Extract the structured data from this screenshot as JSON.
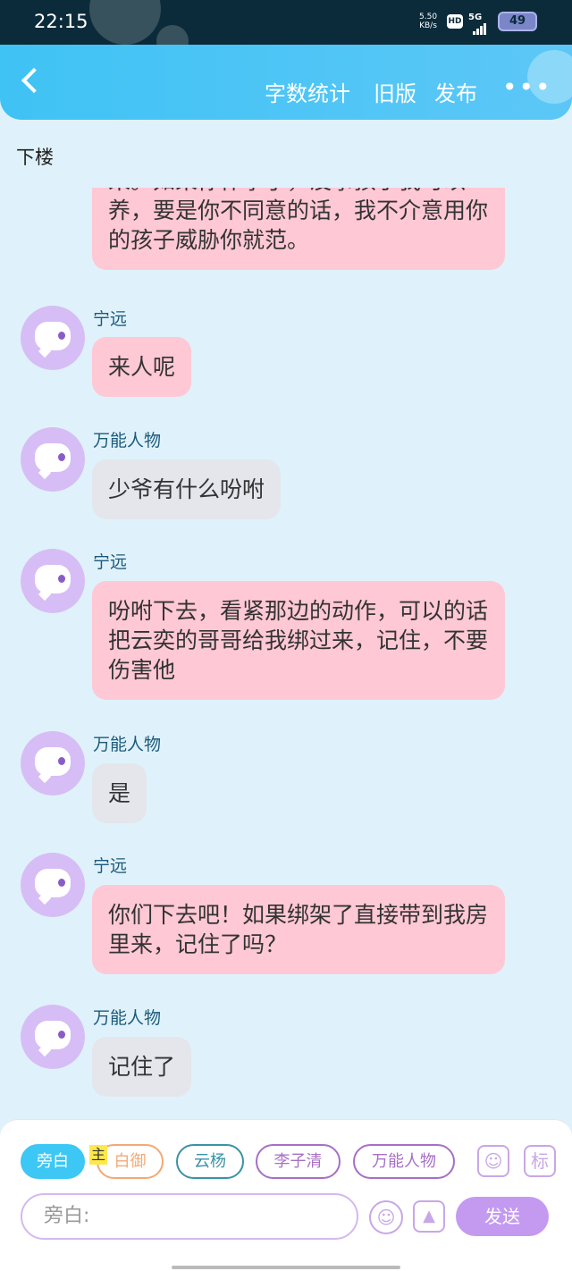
{
  "status": {
    "time": "22:15",
    "net_speed": "5.50",
    "net_unit": "KB/s",
    "hd": "HD",
    "signal": "5G",
    "battery": "49"
  },
  "header": {
    "actions": [
      "字数统计",
      "旧版",
      "发布"
    ],
    "more": "•••"
  },
  "section_label": "下楼",
  "messages": [
    {
      "type": "partial",
      "color": "pink",
      "text": "来。如果你怀孕了，没事孩子我可以养，要是你不同意的话，我不介意用你的孩子威胁你就范。"
    },
    {
      "name": "宁远",
      "color": "pink",
      "text": "来人呢"
    },
    {
      "name": "万能人物",
      "color": "gray",
      "text": "少爷有什么吩咐"
    },
    {
      "name": "宁远",
      "color": "pink",
      "text": "吩咐下去，看紧那边的动作，可以的话把云奕的哥哥给我绑过来，记住，不要伤害他"
    },
    {
      "name": "万能人物",
      "color": "gray",
      "text": "是"
    },
    {
      "name": "宁远",
      "color": "pink",
      "text": "你们下去吧！如果绑架了直接带到我房里来，记住了吗？"
    },
    {
      "name": "万能人物",
      "color": "gray",
      "text": "记住了"
    }
  ],
  "composer": {
    "chips": [
      "旁白",
      "白御",
      "云杨",
      "李子清",
      "万能人物"
    ],
    "main_tag": "主",
    "tag_button": "标",
    "input_placeholder": "旁白:",
    "send_label": "发送"
  }
}
